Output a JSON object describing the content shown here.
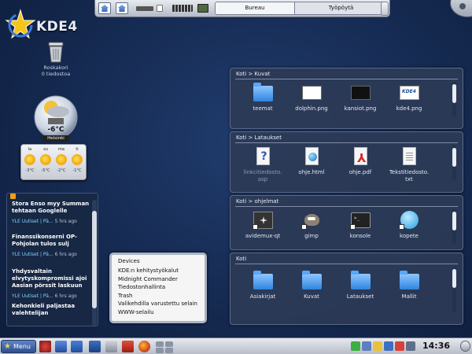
{
  "desktop": {
    "logo_text": "KDE4"
  },
  "trash": {
    "label_line1": "Roskakori",
    "label_line2": "0 tiedostoa"
  },
  "weather": {
    "temperature": "-6°C",
    "city": "Helsinki",
    "forecast_days": [
      "la",
      "su",
      "ma",
      "ti"
    ],
    "forecast_temps": [
      "-3°C",
      "-5°C",
      "-2°C",
      "-1°C"
    ]
  },
  "news": {
    "items": [
      {
        "title": "Stora Enso myy Summan tehtaan Googlelle",
        "source": "YLE Uutiset | Pä...",
        "ago": "5 hrs ago"
      },
      {
        "title": "Finanssikonserni OP-Pohjolan tulos sulj",
        "source": "YLE Uutiset | Pä...",
        "ago": "6 hrs ago"
      },
      {
        "title": "Yhdysvaltain elvytyskompromissi ajoi Aasian pörssit laskuun",
        "source": "YLE Uutiset | Pä...",
        "ago": "6 hrs ago"
      },
      {
        "title": "Kehonkieli paljastaa valehtelijan",
        "source": "",
        "ago": ""
      }
    ]
  },
  "devices": {
    "heading": "Devices",
    "items": [
      "KDE:n kehitystyökalut",
      "Midnight Commander",
      "Tiedostonhallinta",
      "Trash",
      "Valikehdilla varustettu selain",
      "WWW-selailu"
    ]
  },
  "pager": {
    "desktop1": "Bureau",
    "desktop2": "Työpöytä"
  },
  "folder_views": [
    {
      "title": "Koti > Kuvat",
      "items": [
        {
          "label": "teemat",
          "icon": "folder"
        },
        {
          "label": "dolphin.png",
          "icon": "image-white"
        },
        {
          "label": "kansiot.png",
          "icon": "image-dark"
        },
        {
          "label": "kde4.png",
          "icon": "image-kde"
        }
      ]
    },
    {
      "title": "Koti > Lataukset",
      "items": [
        {
          "label": "linkcitiedosto.asp",
          "icon": "unknown-doc"
        },
        {
          "label": "ohje.html",
          "icon": "html-doc"
        },
        {
          "label": "ohje.pdf",
          "icon": "pdf-doc"
        },
        {
          "label": "Tekstitiedosto.txt",
          "icon": "text-doc"
        }
      ]
    },
    {
      "title": "Koti > ohjelmat",
      "items": [
        {
          "label": "avidemux-qt",
          "icon": "film"
        },
        {
          "label": "gimp",
          "icon": "gimp"
        },
        {
          "label": "konsole",
          "icon": "terminal"
        },
        {
          "label": "kopete",
          "icon": "kopete"
        }
      ]
    },
    {
      "title": "Koti",
      "items": [
        {
          "label": "Asiakirjat",
          "icon": "folder"
        },
        {
          "label": "Kuvat",
          "icon": "folder"
        },
        {
          "label": "Lataukset",
          "icon": "folder"
        },
        {
          "label": "Mallit",
          "icon": "folder"
        }
      ]
    }
  ],
  "panel": {
    "menu_label": "Menu",
    "clock": "14:36"
  }
}
